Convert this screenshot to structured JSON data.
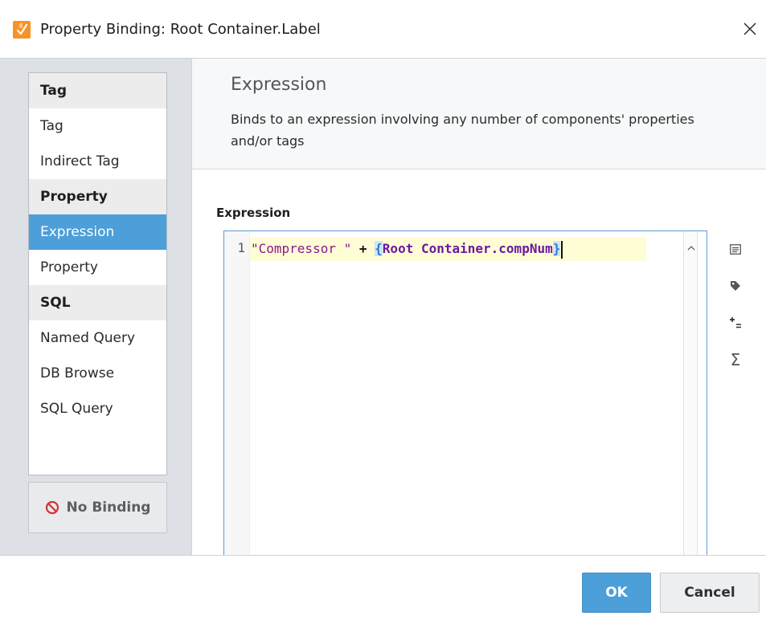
{
  "window": {
    "title": "Property Binding: Root Container.Label",
    "icon": "binding-app-icon",
    "close_glyph": "×"
  },
  "binding_types": [
    {
      "kind": "header",
      "label": "Tag"
    },
    {
      "kind": "item",
      "label": "Tag"
    },
    {
      "kind": "item",
      "label": "Indirect Tag"
    },
    {
      "kind": "header",
      "label": "Property"
    },
    {
      "kind": "item",
      "label": "Expression",
      "selected": true
    },
    {
      "kind": "item",
      "label": "Property"
    },
    {
      "kind": "header",
      "label": "SQL"
    },
    {
      "kind": "item",
      "label": "Named Query"
    },
    {
      "kind": "item",
      "label": "DB Browse"
    },
    {
      "kind": "item",
      "label": "SQL Query"
    }
  ],
  "no_binding_label": "No Binding",
  "selected_type": {
    "title": "Expression",
    "description": "Binds to an expression involving any number of components' properties and/or tags"
  },
  "editor": {
    "label": "Expression",
    "line_number": "1",
    "code": {
      "string_literal": "\"Compressor \"",
      "operator": "+",
      "open_brace": "{",
      "property_ref": "Root Container.compNum",
      "close_brace": "}"
    }
  },
  "toolbar_icons": [
    "list-icon",
    "tag-icon",
    "operator-icon",
    "function-sigma-icon"
  ],
  "toolbar_glyphs": {
    "operator": "+=",
    "sigma": "Σ"
  },
  "footer": {
    "ok_label": "OK",
    "cancel_label": "Cancel"
  },
  "colors": {
    "accent": "#4c9fd9",
    "icon_orange": "#f7922a",
    "no_binding_red": "#d13438",
    "highlight_line": "#fffdd6"
  }
}
